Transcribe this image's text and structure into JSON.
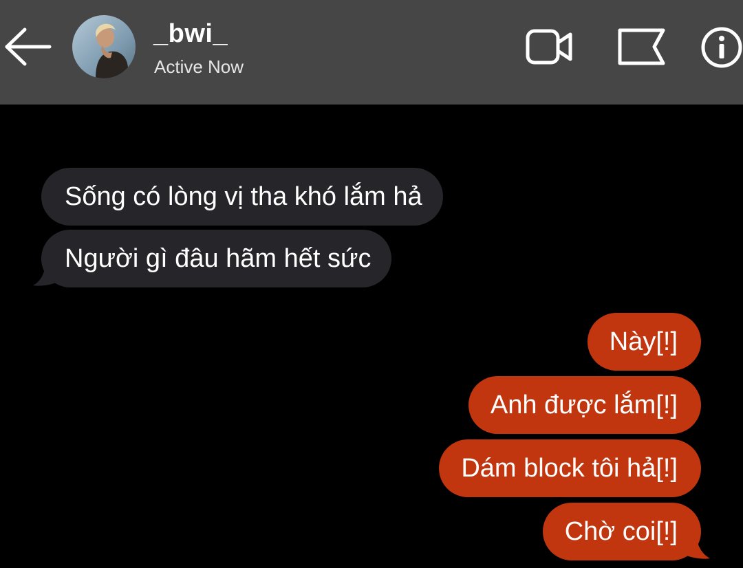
{
  "header": {
    "back_icon": "arrow-left-icon",
    "contact_name": "_bwi_",
    "status": "Active Now",
    "video_icon": "video-camera-icon",
    "flag_icon": "flag-icon",
    "info_icon": "info-icon"
  },
  "messages": {
    "incoming": [
      {
        "text": "Sống có lòng vị tha khó lắm hả"
      },
      {
        "text": "Người gì đâu hãm hết sức"
      }
    ],
    "outgoing": [
      {
        "text": "Này[!]"
      },
      {
        "text": "Anh được lắm[!]"
      },
      {
        "text": "Dám block tôi hả[!]"
      },
      {
        "text": "Chờ coi[!]"
      }
    ]
  },
  "colors": {
    "header_bg": "#464646",
    "background": "#000000",
    "incoming_bubble": "#26252a",
    "outgoing_bubble": "#c2360f",
    "text": "#ffffff"
  }
}
